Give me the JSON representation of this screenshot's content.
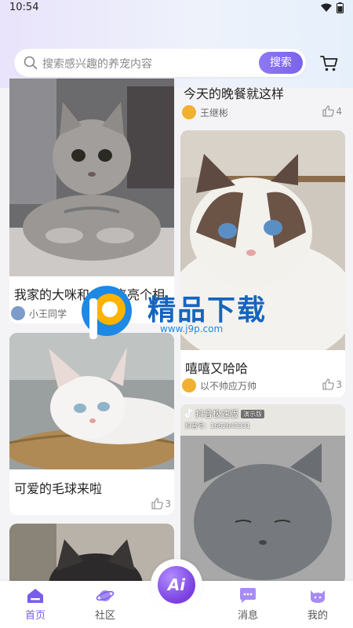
{
  "status_bar": {
    "time": "10:54"
  },
  "search": {
    "placeholder": "搜索感兴趣的养宠内容",
    "button_label": "搜索"
  },
  "feed": {
    "left_column": [
      {
        "title": "我家的大咪和小咪来亮个相",
        "author": "小王同学",
        "likes": ""
      },
      {
        "title": "可爱的毛球来啦",
        "author": "",
        "likes": "3"
      },
      {
        "title": "",
        "author": "",
        "likes": ""
      }
    ],
    "right_column": [
      {
        "title": "今天的晚餐就这样",
        "author": "王继彬",
        "likes": "4"
      },
      {
        "title": "嘻嘻又哈哈",
        "author": "以不帅应万帅",
        "likes": "3"
      },
      {
        "title": "",
        "author": "",
        "likes": "",
        "overlay_app": "抖音极速版",
        "overlay_badge": "演示版",
        "overlay_id": "抖音号：1662643331"
      }
    ]
  },
  "watermark": {
    "brand": "精品下载",
    "url": "www.j9p.com"
  },
  "bottom_nav": {
    "items": [
      {
        "label": "首页",
        "icon": "home-icon",
        "active": true
      },
      {
        "label": "社区",
        "icon": "planet-icon",
        "active": false
      },
      {
        "label": "Ai",
        "icon": "ai-icon",
        "active": false
      },
      {
        "label": "消息",
        "icon": "message-icon",
        "active": false
      },
      {
        "label": "我的",
        "icon": "profile-icon",
        "active": false
      }
    ]
  },
  "colors": {
    "accent": "#7a5cf0",
    "button": "#8e79f2"
  }
}
